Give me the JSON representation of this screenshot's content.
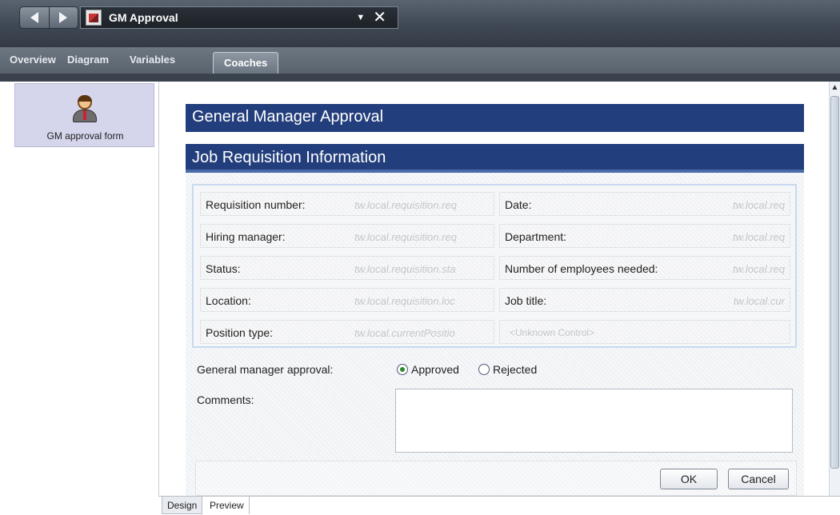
{
  "window": {
    "title": "GM Approval",
    "icons": {
      "back": "arrow-left-icon",
      "forward": "arrow-right-icon",
      "dropdown": "chevron-down-icon",
      "close": "close-icon",
      "app": "process-app-icon"
    }
  },
  "tabs": [
    {
      "label": "Overview"
    },
    {
      "label": "Diagram"
    },
    {
      "label": "Variables"
    },
    {
      "label": "Coaches",
      "active": true
    }
  ],
  "palette": {
    "items": [
      {
        "label": "GM approval form",
        "icon": "user-icon"
      }
    ]
  },
  "form": {
    "title": "General Manager Approval",
    "section_title": "Job Requisition Information",
    "left_fields": [
      {
        "label": "Requisition number:",
        "value": "tw.local.requisition.req"
      },
      {
        "label": "Hiring manager:",
        "value": "tw.local.requisition.req"
      },
      {
        "label": "Status:",
        "value": "tw.local.requisition.sta"
      },
      {
        "label": "Location:",
        "value": "tw.local.requisition.loc"
      },
      {
        "label": "Position type:",
        "value": "tw.local.currentPositio"
      }
    ],
    "right_fields": [
      {
        "label": "Date:",
        "value": "tw.local.req"
      },
      {
        "label": "Department:",
        "value": "tw.local.req"
      },
      {
        "label": "Number of employees needed:",
        "value": "tw.local.req"
      },
      {
        "label": "Job title:",
        "value": "tw.local.cur"
      },
      {
        "label": "<Unknown Control>",
        "value": ""
      }
    ],
    "approval": {
      "label": "General manager approval:",
      "options": [
        "Approved",
        "Rejected"
      ],
      "selected": "Approved"
    },
    "comments": {
      "label": "Comments:",
      "value": ""
    },
    "buttons": {
      "ok": "OK",
      "cancel": "Cancel"
    }
  },
  "bottom_tabs": [
    {
      "label": "Design",
      "active": true
    },
    {
      "label": "Preview"
    }
  ],
  "colors": {
    "header_blue": "#233e7c",
    "toolbar_dark": "#3e4753",
    "palette_item_bg": "#d5d5ec"
  }
}
